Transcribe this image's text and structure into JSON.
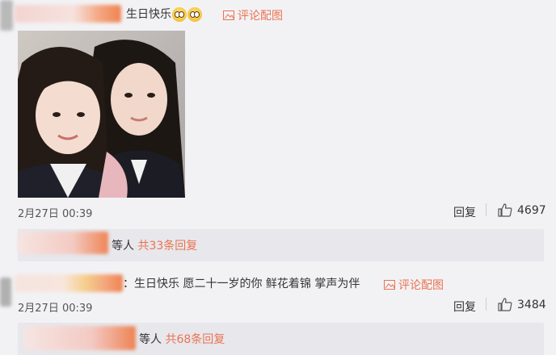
{
  "comment1": {
    "text": "生日快乐",
    "emojis": [
      "pleading-face",
      "pleading-face"
    ],
    "pic_link": "评论配图",
    "timestamp": "2月27日 00:39",
    "reply_action": "回复",
    "like_count": "4697",
    "replies_suffix": "等人",
    "replies_count": "共33条回复"
  },
  "comment2": {
    "text": "：生日快乐 愿二十一岁的你 鲜花着锦 掌声为伴",
    "pic_link": "评论配图",
    "timestamp": "2月27日 00:39",
    "reply_action": "回复",
    "like_count": "3484",
    "replies_suffix": "等人",
    "replies_count": "共68条回复"
  },
  "colors": {
    "background": "#f2f2f5",
    "link": "#eb7350",
    "reply_box": "#e7e7ec"
  }
}
